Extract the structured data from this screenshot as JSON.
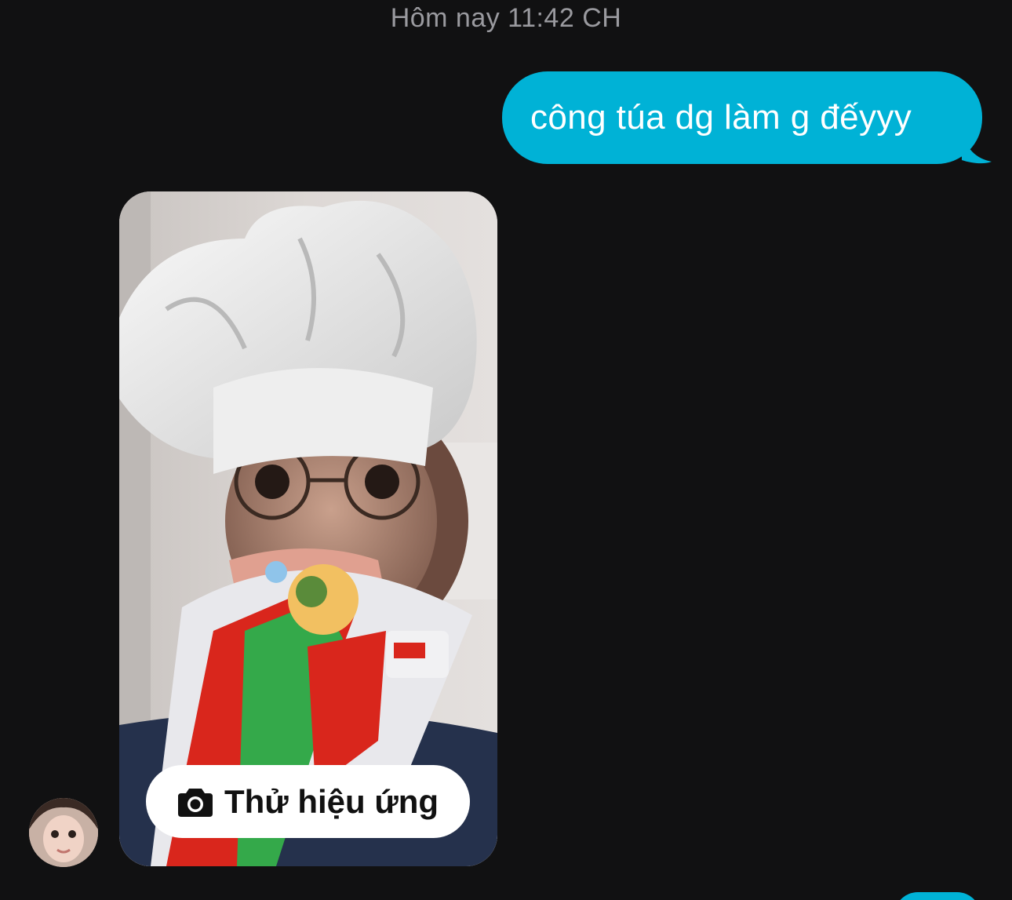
{
  "conversation": {
    "timestamp": "Hôm nay 11:42 CH",
    "outgoing_message": "công túa dg làm g đếyyy",
    "media": {
      "icon": "camera-icon",
      "try_effect_label": "Thử hiệu ứng"
    }
  },
  "colors": {
    "background": "#111112",
    "outgoing_bubble": "#00b2d6",
    "timestamp_text": "#9a9a9f"
  }
}
